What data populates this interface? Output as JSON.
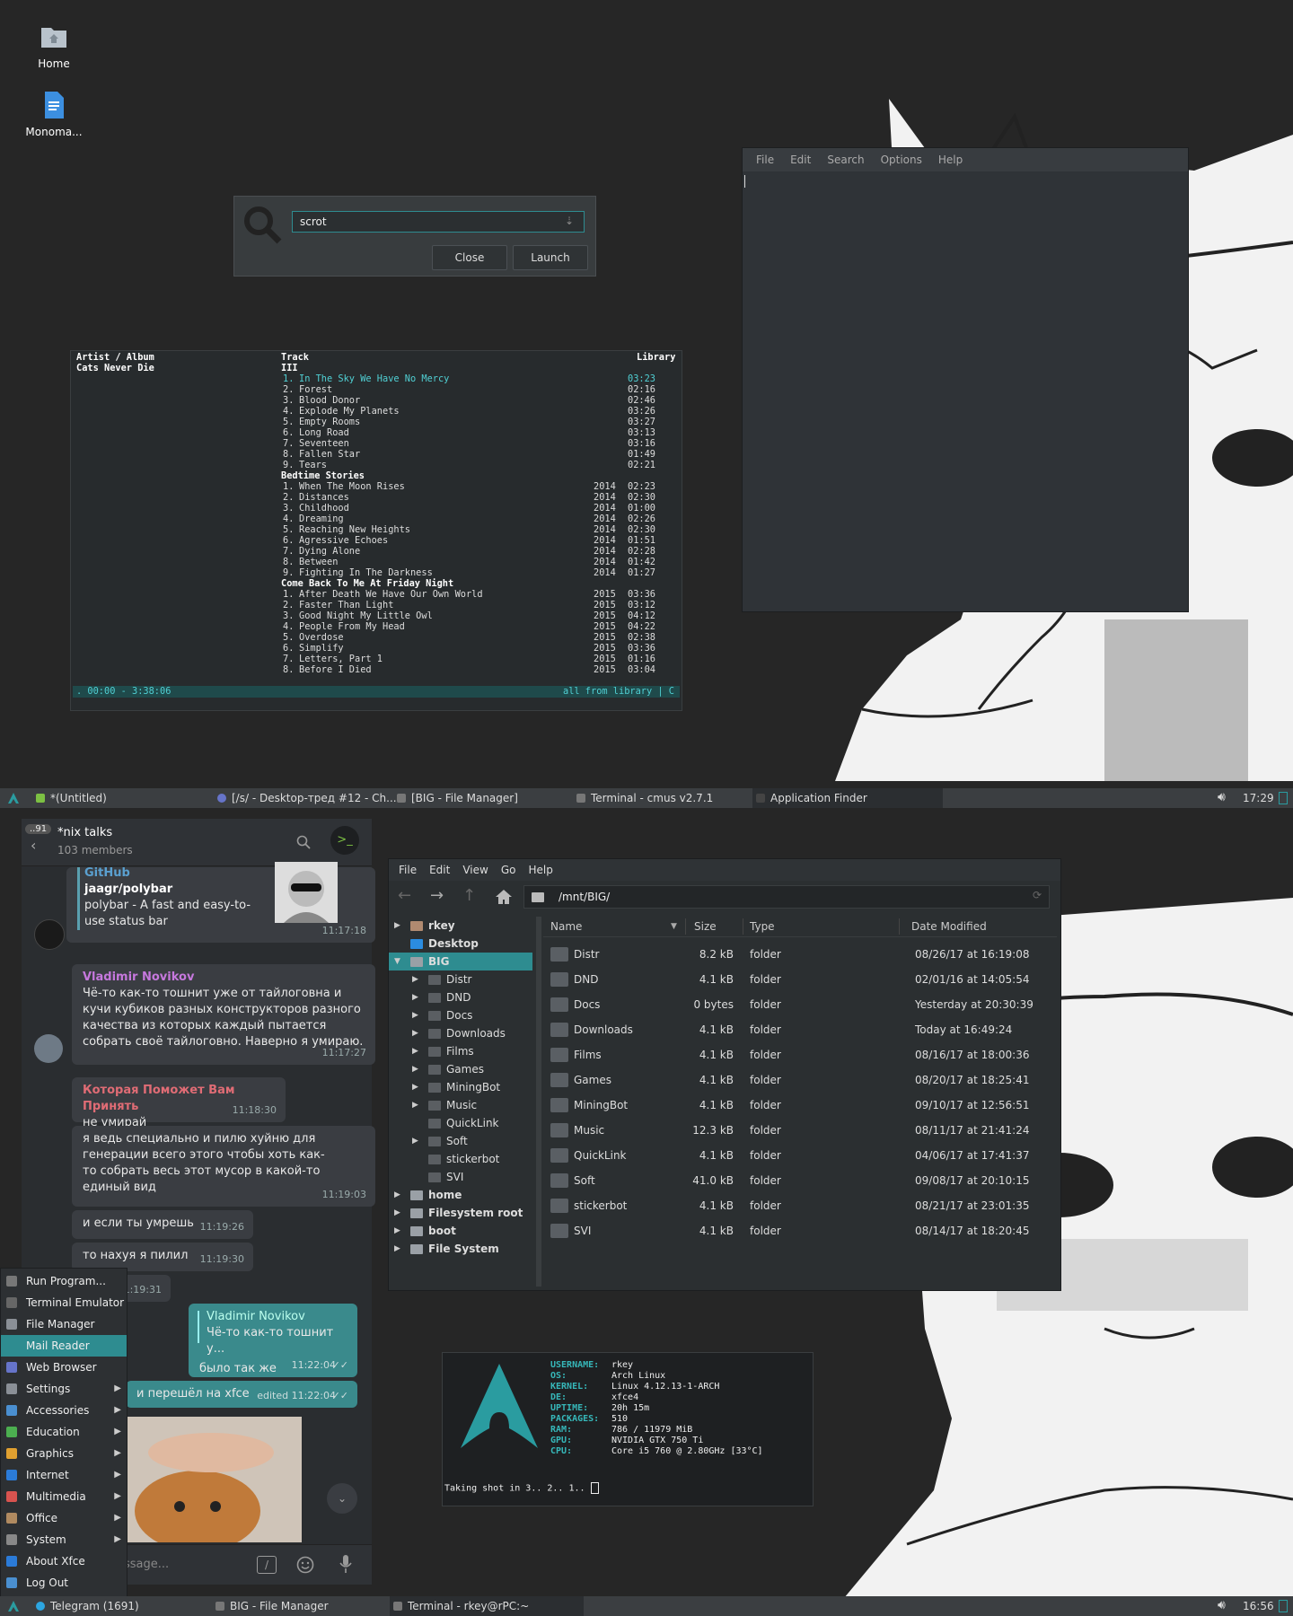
{
  "desktop": {
    "icons": [
      {
        "label": "Home",
        "icon": "home-folder-icon"
      },
      {
        "label": "Monoma...",
        "icon": "document-icon"
      }
    ]
  },
  "app_finder": {
    "search_value": "scrot",
    "close_label": "Close",
    "launch_label": "Launch"
  },
  "editor": {
    "menu": [
      "File",
      "Edit",
      "Search",
      "Options",
      "Help"
    ]
  },
  "cmus": {
    "header_artist": "Artist / Album",
    "header_track": "Track",
    "header_library": "Library",
    "artist": "Cats Never Die",
    "albums": [
      {
        "name": "III",
        "tracks": [
          {
            "n": "1.",
            "title": "In The Sky We Have No Mercy",
            "year": "",
            "dur": "03:23"
          },
          {
            "n": "2.",
            "title": "Forest",
            "year": "",
            "dur": "02:16"
          },
          {
            "n": "3.",
            "title": "Blood Donor",
            "year": "",
            "dur": "02:46"
          },
          {
            "n": "4.",
            "title": "Explode My Planets",
            "year": "",
            "dur": "03:26"
          },
          {
            "n": "5.",
            "title": "Empty Rooms",
            "year": "",
            "dur": "03:27"
          },
          {
            "n": "6.",
            "title": "Long Road",
            "year": "",
            "dur": "03:13"
          },
          {
            "n": "7.",
            "title": "Seventeen",
            "year": "",
            "dur": "03:16"
          },
          {
            "n": "8.",
            "title": "Fallen Star",
            "year": "",
            "dur": "01:49"
          },
          {
            "n": "9.",
            "title": "Tears",
            "year": "",
            "dur": "02:21"
          }
        ]
      },
      {
        "name": "Bedtime Stories",
        "tracks": [
          {
            "n": "1.",
            "title": "When The Moon Rises",
            "year": "2014",
            "dur": "02:23"
          },
          {
            "n": "2.",
            "title": "Distances",
            "year": "2014",
            "dur": "02:30"
          },
          {
            "n": "3.",
            "title": "Childhood",
            "year": "2014",
            "dur": "01:00"
          },
          {
            "n": "4.",
            "title": "Dreaming",
            "year": "2014",
            "dur": "02:26"
          },
          {
            "n": "5.",
            "title": "Reaching New Heights",
            "year": "2014",
            "dur": "02:30"
          },
          {
            "n": "6.",
            "title": "Agressive Echoes",
            "year": "2014",
            "dur": "01:51"
          },
          {
            "n": "7.",
            "title": "Dying Alone",
            "year": "2014",
            "dur": "02:28"
          },
          {
            "n": "8.",
            "title": "Between",
            "year": "2014",
            "dur": "01:42"
          },
          {
            "n": "9.",
            "title": "Fighting In The Darkness",
            "year": "2014",
            "dur": "01:27"
          }
        ]
      },
      {
        "name": "Come Back To Me At Friday Night",
        "tracks": [
          {
            "n": "1.",
            "title": "After Death We Have Our Own World",
            "year": "2015",
            "dur": "03:36"
          },
          {
            "n": "2.",
            "title": "Faster Than Light",
            "year": "2015",
            "dur": "03:12"
          },
          {
            "n": "3.",
            "title": "Good Night My Little Owl",
            "year": "2015",
            "dur": "04:12"
          },
          {
            "n": "4.",
            "title": "People From My Head",
            "year": "2015",
            "dur": "04:22"
          },
          {
            "n": "5.",
            "title": "Overdose",
            "year": "2015",
            "dur": "02:38"
          },
          {
            "n": "6.",
            "title": "Simplify",
            "year": "2015",
            "dur": "03:36"
          },
          {
            "n": "7.",
            "title": "Letters, Part 1",
            "year": "2015",
            "dur": "01:16"
          },
          {
            "n": "8.",
            "title": "Before I Died",
            "year": "2015",
            "dur": "03:04"
          }
        ]
      }
    ],
    "status_left": ". 00:00 - 3:38:06",
    "status_right": "all from library | C"
  },
  "taskbar_top": {
    "tasks": [
      "*(Untitled)",
      "[/s/ - Desktop-тред #12 - Ch...",
      "[BIG - File Manager]",
      "Terminal - cmus v2.7.1",
      "Application Finder"
    ],
    "time": "17:29"
  },
  "taskbar_bottom": {
    "tasks": [
      "Telegram (1691)",
      "BIG - File Manager",
      "Terminal - rkey@rPC:~"
    ],
    "time": "16:56"
  },
  "telegram": {
    "badge": "91",
    "chat_title": "*nix talks",
    "members": "103 members",
    "messages": {
      "github_source": "GitHub",
      "github_title": "jaagr/polybar",
      "github_desc": "polybar - A fast and easy-to-use status bar",
      "github_time": "11:17:18",
      "m1_author": "Vladimir Novikov",
      "m1_text": "Чё-то как-то тошнит уже от тайлоговна и кучи кубиков разных конструкторов разного качества из которых каждый пытается собрать своё тайлоговно. Наверно я умираю.",
      "m1_time": "11:17:27",
      "m2_author": "Которая Поможет Вам Принять",
      "m2_text": "не умирай",
      "m2_time": "11:18:30",
      "m3_text": "я ведь специально и пилю хуйню для генерации всего этого чтобы хоть как-то собрать весь этот мусор в какой-то единый вид",
      "m3_time": "11:19:03",
      "m4_text": "и если ты умрешь",
      "m4_time": "11:19:26",
      "m5_text": "то нахуя я пилил",
      "m5_time": "11:19:30",
      "m6_time": "11:19:31",
      "reply_author": "Vladimir Novikov",
      "reply_quote": "Чё-то как-то тошнит у...",
      "reply_text": "было так же",
      "reply_time": "11:22:04",
      "m8_text": "и перешёл на xfce",
      "m8_time": "edited 11:22:04"
    },
    "input_placeholder": "ssage..."
  },
  "xfce_menu": {
    "items": [
      {
        "label": "Run Program...",
        "sub": false
      },
      {
        "label": "Terminal Emulator",
        "sub": false
      },
      {
        "label": "File Manager",
        "sub": false
      },
      {
        "label": "Mail Reader",
        "sub": false
      },
      {
        "label": "Web Browser",
        "sub": false
      },
      {
        "label": "Settings",
        "sub": true
      },
      {
        "label": "Accessories",
        "sub": true
      },
      {
        "label": "Education",
        "sub": true
      },
      {
        "label": "Graphics",
        "sub": true
      },
      {
        "label": "Internet",
        "sub": true
      },
      {
        "label": "Multimedia",
        "sub": true
      },
      {
        "label": "Office",
        "sub": true
      },
      {
        "label": "System",
        "sub": true
      },
      {
        "label": "About Xfce",
        "sub": false
      },
      {
        "label": "Log Out",
        "sub": false
      }
    ],
    "selected": "Mail Reader"
  },
  "file_manager": {
    "menu": [
      "File",
      "Edit",
      "View",
      "Go",
      "Help"
    ],
    "path": "/mnt/BIG/",
    "tree": [
      {
        "label": "rkey",
        "level": 0,
        "expander": "▶",
        "bold": true
      },
      {
        "label": "Desktop",
        "level": 0,
        "expander": "",
        "bold": true
      },
      {
        "label": "BIG",
        "level": 0,
        "expander": "▼",
        "bold": true
      },
      {
        "label": "Distr",
        "level": 1,
        "expander": "▶",
        "bold": false
      },
      {
        "label": "DND",
        "level": 1,
        "expander": "▶",
        "bold": false
      },
      {
        "label": "Docs",
        "level": 1,
        "expander": "▶",
        "bold": false
      },
      {
        "label": "Downloads",
        "level": 1,
        "expander": "▶",
        "bold": false
      },
      {
        "label": "Films",
        "level": 1,
        "expander": "▶",
        "bold": false
      },
      {
        "label": "Games",
        "level": 1,
        "expander": "▶",
        "bold": false
      },
      {
        "label": "MiningBot",
        "level": 1,
        "expander": "▶",
        "bold": false
      },
      {
        "label": "Music",
        "level": 1,
        "expander": "▶",
        "bold": false
      },
      {
        "label": "QuickLink",
        "level": 1,
        "expander": "",
        "bold": false
      },
      {
        "label": "Soft",
        "level": 1,
        "expander": "▶",
        "bold": false
      },
      {
        "label": "stickerbot",
        "level": 1,
        "expander": "",
        "bold": false
      },
      {
        "label": "SVI",
        "level": 1,
        "expander": "",
        "bold": false
      },
      {
        "label": "home",
        "level": 0,
        "expander": "▶",
        "bold": true
      },
      {
        "label": "Filesystem root",
        "level": 0,
        "expander": "▶",
        "bold": true
      },
      {
        "label": "boot",
        "level": 0,
        "expander": "▶",
        "bold": true
      },
      {
        "label": "File System",
        "level": 0,
        "expander": "▶",
        "bold": true
      }
    ],
    "selected_tree": "BIG",
    "columns": [
      "Name",
      "Size",
      "Type",
      "Date Modified"
    ],
    "rows": [
      {
        "name": "Distr",
        "size": "8.2 kB",
        "type": "folder",
        "date": "08/26/17 at 16:19:08"
      },
      {
        "name": "DND",
        "size": "4.1 kB",
        "type": "folder",
        "date": "02/01/16 at 14:05:54"
      },
      {
        "name": "Docs",
        "size": "0 bytes",
        "type": "folder",
        "date": "Yesterday at 20:30:39"
      },
      {
        "name": "Downloads",
        "size": "4.1 kB",
        "type": "folder",
        "date": "Today at 16:49:24"
      },
      {
        "name": "Films",
        "size": "4.1 kB",
        "type": "folder",
        "date": "08/16/17 at 18:00:36"
      },
      {
        "name": "Games",
        "size": "4.1 kB",
        "type": "folder",
        "date": "08/20/17 at 18:25:41"
      },
      {
        "name": "MiningBot",
        "size": "4.1 kB",
        "type": "folder",
        "date": "09/10/17 at 12:56:51"
      },
      {
        "name": "Music",
        "size": "12.3 kB",
        "type": "folder",
        "date": "08/11/17 at 21:41:24"
      },
      {
        "name": "QuickLink",
        "size": "4.1 kB",
        "type": "folder",
        "date": "04/06/17 at 17:41:37"
      },
      {
        "name": "Soft",
        "size": "41.0 kB",
        "type": "folder",
        "date": "09/08/17 at 20:10:15"
      },
      {
        "name": "stickerbot",
        "size": "4.1 kB",
        "type": "folder",
        "date": "08/21/17 at 23:01:35"
      },
      {
        "name": "SVI",
        "size": "4.1 kB",
        "type": "folder",
        "date": "08/14/17 at 18:20:45"
      }
    ]
  },
  "neofetch": {
    "info": [
      {
        "k": "USERNAME:",
        "v": "rkey"
      },
      {
        "k": "OS:",
        "v": "Arch Linux"
      },
      {
        "k": "KERNEL:",
        "v": "Linux 4.12.13-1-ARCH"
      },
      {
        "k": "DE:",
        "v": "xfce4"
      },
      {
        "k": "UPTIME:",
        "v": "20h 15m"
      },
      {
        "k": "PACKAGES:",
        "v": "510"
      },
      {
        "k": "RAM:",
        "v": "786 / 11979 MiB"
      },
      {
        "k": "GPU:",
        "v": "NVIDIA GTX 750 Ti"
      },
      {
        "k": "CPU:",
        "v": "Core i5 760  @ 2.80GHz [33°C]"
      }
    ],
    "prompt": "Taking shot in 3.. 2.. 1.."
  },
  "colors": {
    "accent": "#2e8c90",
    "arch_blue": "#2a9ca0",
    "tg_name_purple": "#c678dd",
    "tg_name_red": "#e06c75"
  }
}
